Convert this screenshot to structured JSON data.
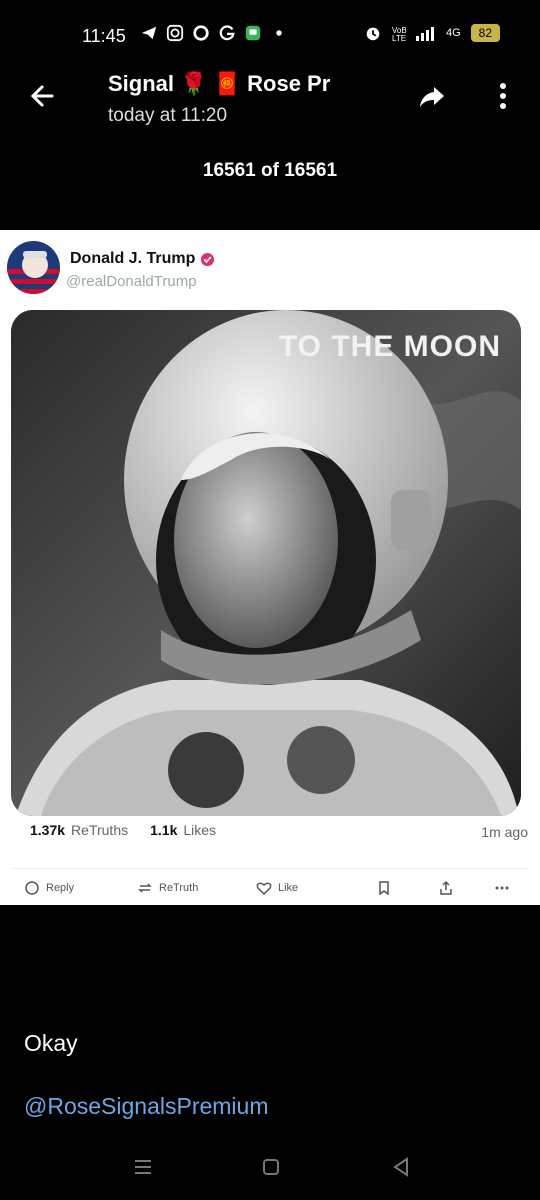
{
  "status": {
    "time": "11:45",
    "battery": "82",
    "network": "4G"
  },
  "header": {
    "title": "Signal 🌹 🧧 Rose Pr",
    "subtitle": "today at 11:20",
    "counter": "16561 of 16561"
  },
  "post": {
    "author": "Donald J. Trump",
    "handle": "@realDonaldTrump",
    "image_caption": "TO THE MOON",
    "retruths_count": "1.37k",
    "retruths_label": "ReTruths",
    "likes_count": "1.1k",
    "likes_label": "Likes",
    "time_ago": "1m ago",
    "actions": {
      "reply": "Reply",
      "retruth": "ReTruth",
      "like": "Like"
    }
  },
  "message": {
    "text": "Okay",
    "mention": "@RoseSignalsPremium"
  },
  "colors": {
    "background": "#000000",
    "link": "#6aa8e6",
    "verified": "#e0306a"
  }
}
